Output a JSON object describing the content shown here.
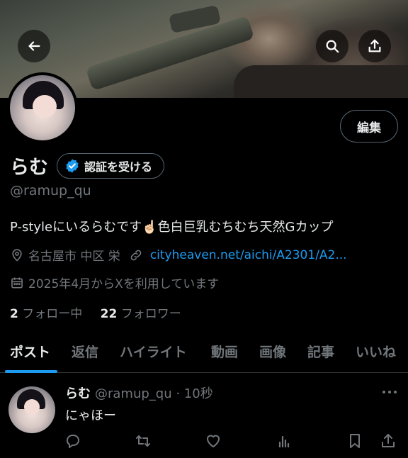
{
  "header": {
    "back_icon": "back-arrow-icon",
    "search_icon": "search-icon",
    "share_icon": "share-icon"
  },
  "profile": {
    "edit_label": "編集",
    "display_name": "らむ",
    "verify_label": "認証を受ける",
    "handle": "@ramup_qu",
    "bio": "P-styleにいるらむです☝🏻色白巨乳むちむち天然Gカップ",
    "location": "名古屋市 中区 栄",
    "link": "cityheaven.net/aichi/A2301/A2...",
    "joined": "2025年4月からXを利用しています",
    "following_count": "2",
    "following_label": "フォロー中",
    "followers_count": "22",
    "followers_label": "フォロワー"
  },
  "tabs": [
    "ポスト",
    "返信",
    "ハイライト",
    "動画",
    "画像",
    "記事",
    "いいね"
  ],
  "post": {
    "name": "らむ",
    "meta": "@ramup_qu · 10秒",
    "text": "にゃほー"
  },
  "colors": {
    "accent": "#1d9bf0",
    "secondary_text": "#71767b",
    "border": "#2f3336"
  }
}
